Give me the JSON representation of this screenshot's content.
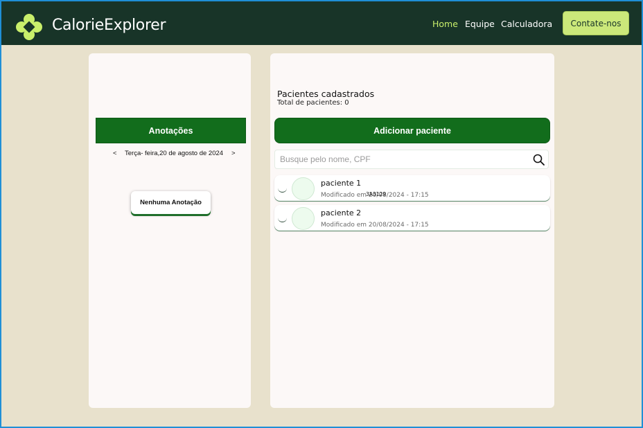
{
  "nav": {
    "brand": "CalorieExplorer",
    "links": [
      "Home",
      "Equipe",
      "Calculadora"
    ],
    "contact_label": "Contate-nos"
  },
  "notes": {
    "header": "Anotações",
    "prev_label": "<",
    "date": "Terça- feira,20 de agosto de 2024",
    "next_label": ">",
    "empty_label": "Nenhuma Anotação"
  },
  "patients": {
    "title": "Pacientes cadastrados",
    "total": "Total de pacientes: 0",
    "add_label": "Adicionar paciente",
    "search_placeholder": "Busque pelo nome, CPF",
    "search_icon": "search-icon",
    "list": [
      {
        "name": "paciente 1",
        "modified": "Modificado em 20/08/2024 - 17:15",
        "overlay": "3A3129"
      },
      {
        "name": "paciente 2",
        "modified": "Modificado em 20/08/2024 - 17:15"
      }
    ]
  },
  "colors": {
    "navbar": "#183428",
    "accent": "#c9ef6b",
    "primary_green": "#126d1c",
    "background": "#e8e1cc",
    "panel": "#fcf8f7"
  }
}
